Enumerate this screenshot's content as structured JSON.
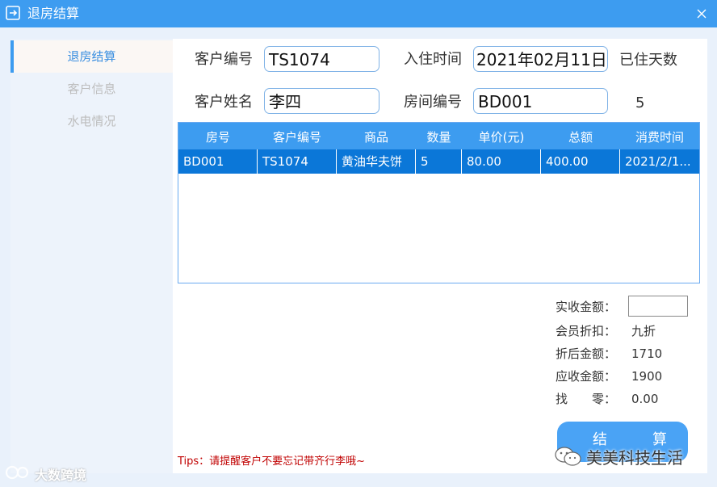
{
  "window": {
    "title": "退房结算"
  },
  "sidebar": {
    "items": [
      {
        "label": "退房结算",
        "active": true
      },
      {
        "label": "客户信息",
        "active": false
      },
      {
        "label": "水电情况",
        "active": false
      }
    ]
  },
  "form": {
    "customer_id_label": "客户编号",
    "customer_id_value": "TS1074",
    "checkin_label": "入住时间",
    "checkin_value": "2021年02月11日",
    "days_label": "已住天数",
    "days_value": "5",
    "name_label": "客户姓名",
    "name_value": "李四",
    "room_label": "房间编号",
    "room_value": "BD001"
  },
  "table": {
    "columns": [
      "房号",
      "客户编号",
      "商品",
      "数量",
      "单价(元)",
      "总额",
      "消费时间"
    ],
    "rows": [
      [
        "BD001",
        "TS1074",
        "黄油华夫饼",
        "5",
        "80.00",
        "400.00",
        "2021/2/1..."
      ]
    ]
  },
  "summary": {
    "received_label": "实收金额：",
    "received_value": "",
    "discount_label": "会员折扣：",
    "discount_value": "九折",
    "after_discount_label": "折后金额：",
    "after_discount_value": "1710",
    "due_label": "应收金额：",
    "due_value": "1900",
    "change_label_1": "找",
    "change_label_2": "零：",
    "change_value": "0.00"
  },
  "settle_button": {
    "char1": "结",
    "char2": "算"
  },
  "tips": "Tips：请提醒客户不要忘记带齐行李哦~",
  "watermarks": {
    "left": "大数跨境",
    "right": "美美科技生活"
  },
  "colors": {
    "accent": "#3d9cf0",
    "row_selected": "#0b77d8",
    "tips": "#c00000"
  }
}
